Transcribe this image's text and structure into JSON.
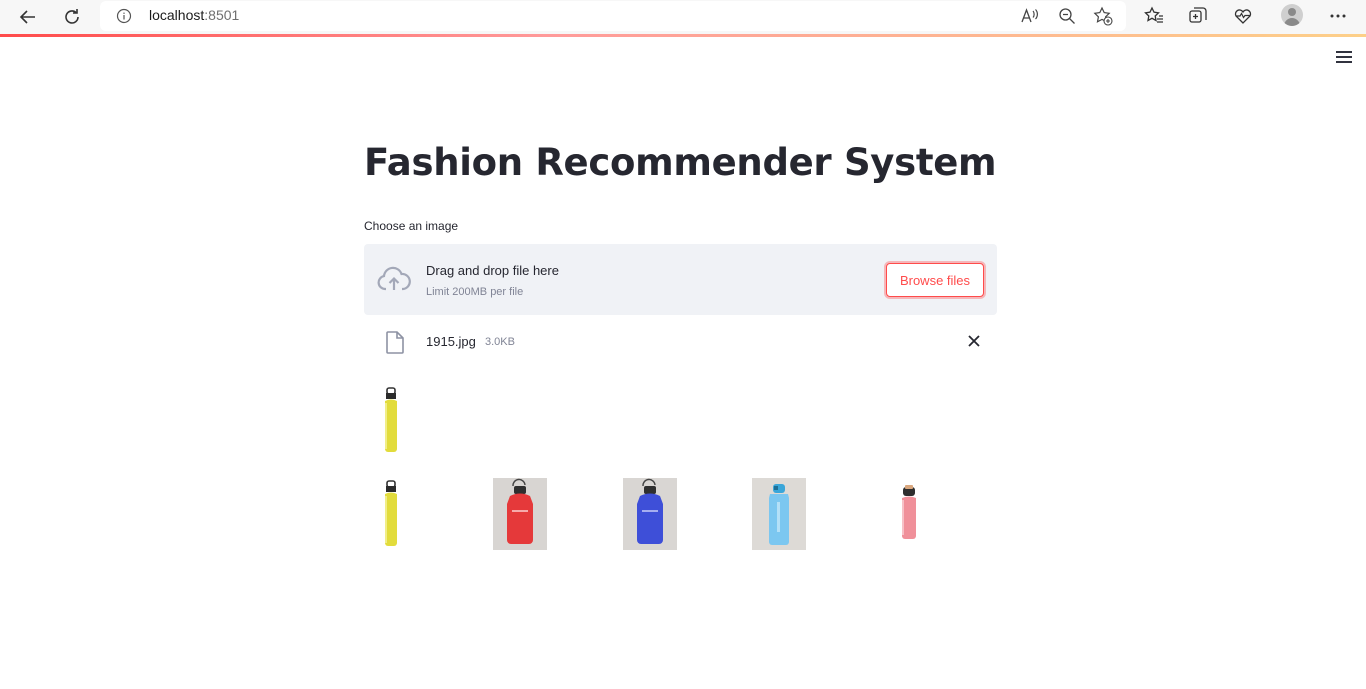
{
  "browser": {
    "url_host": "localhost",
    "url_port": ":8501",
    "icons": [
      "back-arrow-icon",
      "refresh-icon",
      "info-icon",
      "read-aloud-icon",
      "zoom-out-icon",
      "add-favorite-icon",
      "favorites-icon",
      "collections-icon",
      "performance-icon",
      "profile-avatar",
      "more-icon"
    ],
    "read_aloud_glyph": "Aᴬ"
  },
  "app": {
    "title": "Fashion Recommender System",
    "uploader": {
      "label": "Choose an image",
      "drag_text": "Drag and drop file here",
      "limit_text": "Limit 200MB per file",
      "browse_label": "Browse files",
      "accent_color": "#ff4b4b"
    },
    "uploaded_file": {
      "name": "1915.jpg",
      "size": "3.0KB"
    },
    "images": {
      "query": {
        "description": "yellow bottle"
      },
      "recommendations": [
        {
          "description": "yellow bottle"
        },
        {
          "description": "red bottle"
        },
        {
          "description": "blue bottle"
        },
        {
          "description": "light blue bottle"
        },
        {
          "description": "pink bottle"
        }
      ]
    }
  }
}
